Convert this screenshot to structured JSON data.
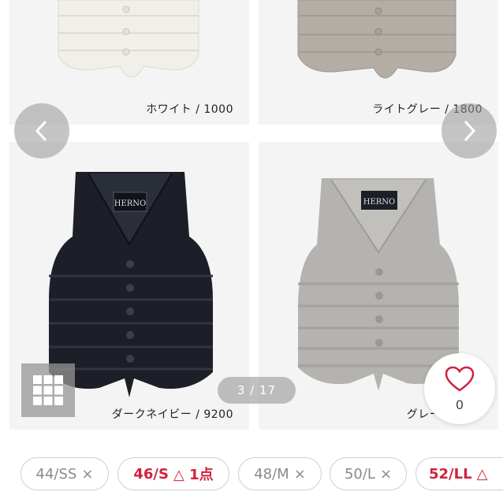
{
  "products": [
    {
      "caption": "ホワイト / 1000",
      "color": "#f1efe9"
    },
    {
      "caption": "ライトグレー / 1800",
      "color": "#b4ada5"
    },
    {
      "caption": "ダークネイビー / 9200",
      "color": "#1c1f28"
    },
    {
      "caption": "グレー / 9406",
      "color": "#b5b3af"
    }
  ],
  "brand_label": "HERNO",
  "carousel": {
    "prev_icon": "chevron-left-icon",
    "next_icon": "chevron-right-icon",
    "counter": "3 / 17"
  },
  "grid_icon": "grid-icon",
  "favorite": {
    "icon": "heart-icon",
    "count": "0",
    "color": "#d0223e"
  },
  "sizes": [
    {
      "label": "44/SS",
      "status": "×",
      "available": false
    },
    {
      "label": "46/S",
      "status": "△ 1点",
      "available": true
    },
    {
      "label": "48/M",
      "status": "×",
      "available": false
    },
    {
      "label": "50/L",
      "status": "×",
      "available": false
    },
    {
      "label": "52/LL",
      "status": "△",
      "available": true
    }
  ]
}
